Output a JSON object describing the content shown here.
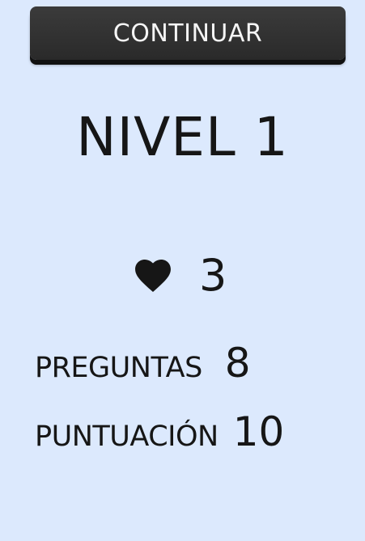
{
  "continue_button": {
    "label": "CONTINUAR"
  },
  "level": {
    "title": "NIVEL 1"
  },
  "lives": {
    "icon": "heart-icon",
    "count": "3"
  },
  "stats": {
    "questions_label": "PREGUNTAS",
    "questions_value": "8",
    "score_label": "PUNTUACIÓN",
    "score_value": "10"
  },
  "colors": {
    "background": "#dce9fd",
    "button": "#333333",
    "text": "#161616"
  }
}
